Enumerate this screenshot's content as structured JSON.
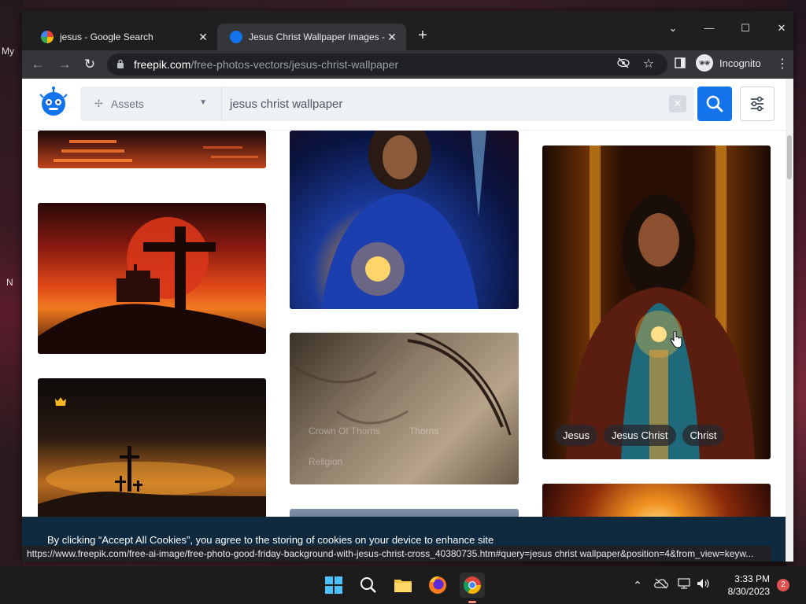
{
  "desktop": {
    "labels": [
      "My",
      "N"
    ]
  },
  "browser": {
    "tabs": [
      {
        "title": "jesus - Google Search",
        "close": "✕"
      },
      {
        "title": "Jesus Christ Wallpaper Images - F",
        "close": "✕"
      }
    ],
    "new_tab": "+",
    "window_controls": {
      "dropdown": "⌄",
      "minimize": "—",
      "maximize": "☐",
      "close": "✕"
    },
    "nav": {
      "back": "←",
      "forward": "→",
      "reload": "↻"
    },
    "url_host": "freepik.com",
    "url_path": "/free-photos-vectors/jesus-christ-wallpaper",
    "incognito_label": "Incognito",
    "menu": "⋮",
    "status_url": "https://www.freepik.com/free-ai-image/free-photo-good-friday-background-with-jesus-christ-cross_40380735.htm#query=jesus christ wallpaper&position=4&from_view=keyw..."
  },
  "site": {
    "assets_label": "Assets",
    "search_query": "jesus christ wallpaper",
    "clear": "✕",
    "image_tags": [
      "Jesus",
      "Jesus Christ",
      "Christ"
    ],
    "faded_tags": [
      "Crown Of Thorns",
      "Thorns",
      "Religion"
    ],
    "cookie_text": "By clicking “Accept All Cookies”, you agree to the storing of cookies on your device to enhance site"
  },
  "taskbar": {
    "time": "3:33 PM",
    "date": "8/30/2023",
    "notification_count": "2"
  }
}
